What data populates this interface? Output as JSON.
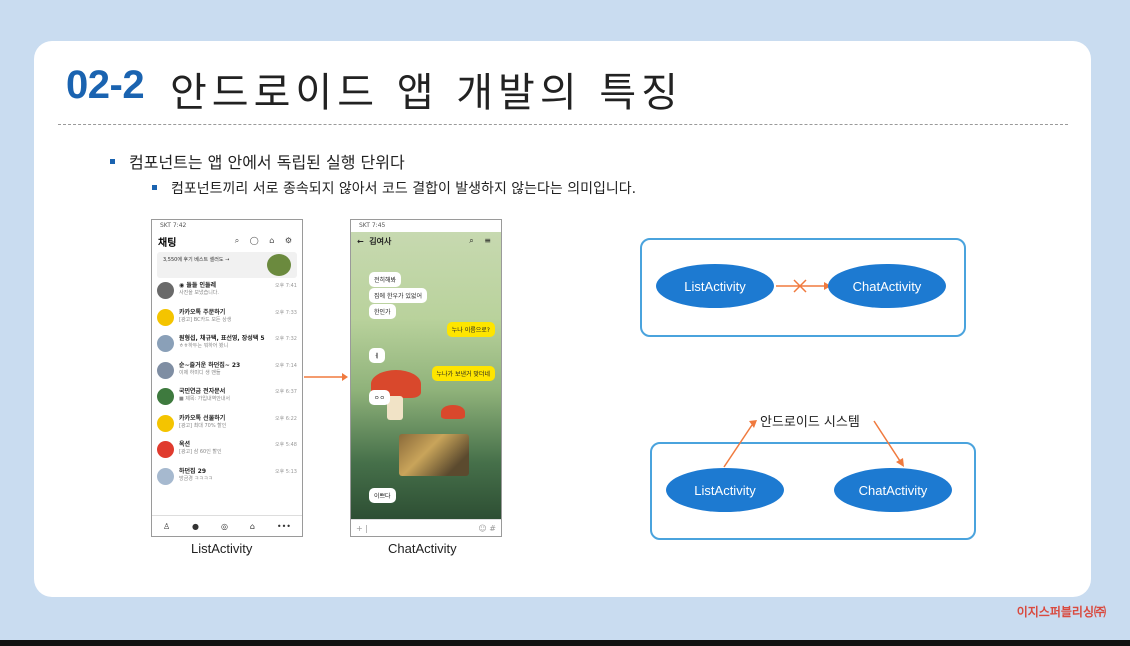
{
  "slide": {
    "title_number": "02-2",
    "title_text": "안드로이드 앱 개발의 특징",
    "bullet_1": "컴포넌트는 앱 안에서 독립된 실행 단위다",
    "bullet_2": "컴포넌트끼리 서로 종속되지 않아서 코드 결합이 발생하지 않는다는 의미입니다."
  },
  "phone_list": {
    "status": "SKT 7:42",
    "header_title": "채팅",
    "banner_text": "3,550에 후기 베스트 셀러도 →",
    "chats": [
      {
        "name": "◉ 들들 인들레",
        "msg": "사진을 보냈습니다.",
        "time": "오후 7:41",
        "color": "#6a6a6a"
      },
      {
        "name": "카카오톡 주문하기",
        "msg": "[광고] BC카드 모든 상생",
        "time": "오후 7:33",
        "color": "#f4c400"
      },
      {
        "name": "원형섭, 채규택, 표선영, 장성택 5",
        "msg": "ㅎㅎ하두는 뭐하어 봤니",
        "time": "오후 7:32",
        "color": "#8aa0b8"
      },
      {
        "name": "순~즐거운 하던집~ 23",
        "msg": "이제 하미디 생 맨들",
        "time": "오후 7:14",
        "color": "#7f8ea3"
      },
      {
        "name": "국민연금 전자문서",
        "msg": "■ 제목: 가입내역안내서",
        "time": "오후 6:37",
        "color": "#3e7a3e"
      },
      {
        "name": "카카오톡 선물하기",
        "msg": "[광고] 최대 70% 할인",
        "time": "오후 6:22",
        "color": "#f4c400"
      },
      {
        "name": "옥션",
        "msg": "[광고] 삼 60인 할인",
        "time": "오후 5:48",
        "color": "#e03b2e"
      },
      {
        "name": "하던집 29",
        "msg": "방금경 ㅋㅋㅋㅋ",
        "time": "오후 5:13",
        "color": "#a6b9cf"
      }
    ],
    "label": "ListActivity"
  },
  "phone_chat": {
    "status": "SKT 7:45",
    "header_title": "김여사",
    "bubbles": [
      {
        "text": "전히해봐",
        "me": false
      },
      {
        "text": "집에 한우가 있없어",
        "me": false
      },
      {
        "text": "한인가",
        "me": false
      },
      {
        "text": "누나 이름으로?",
        "me": true
      },
      {
        "text": "ㅔ",
        "me": false
      },
      {
        "text": "누나가 보낸거 맞더네",
        "me": true
      },
      {
        "text": "ㅇㅇ",
        "me": false
      },
      {
        "text": "이쁘다",
        "me": false
      }
    ],
    "label": "ChatActivity"
  },
  "diagram_top": {
    "left": "ListActivity",
    "right": "ChatActivity"
  },
  "diagram_bottom": {
    "system_label": "안드로이드 시스템",
    "left": "ListActivity",
    "right": "ChatActivity"
  },
  "brand": "이지스퍼블리싱㈜",
  "colors": {
    "accent": "#1a63b0",
    "ellipse": "#1d7ad1",
    "box_border": "#4aa3dd",
    "arrow": "#f07a3e",
    "brand": "#d94a3f"
  }
}
